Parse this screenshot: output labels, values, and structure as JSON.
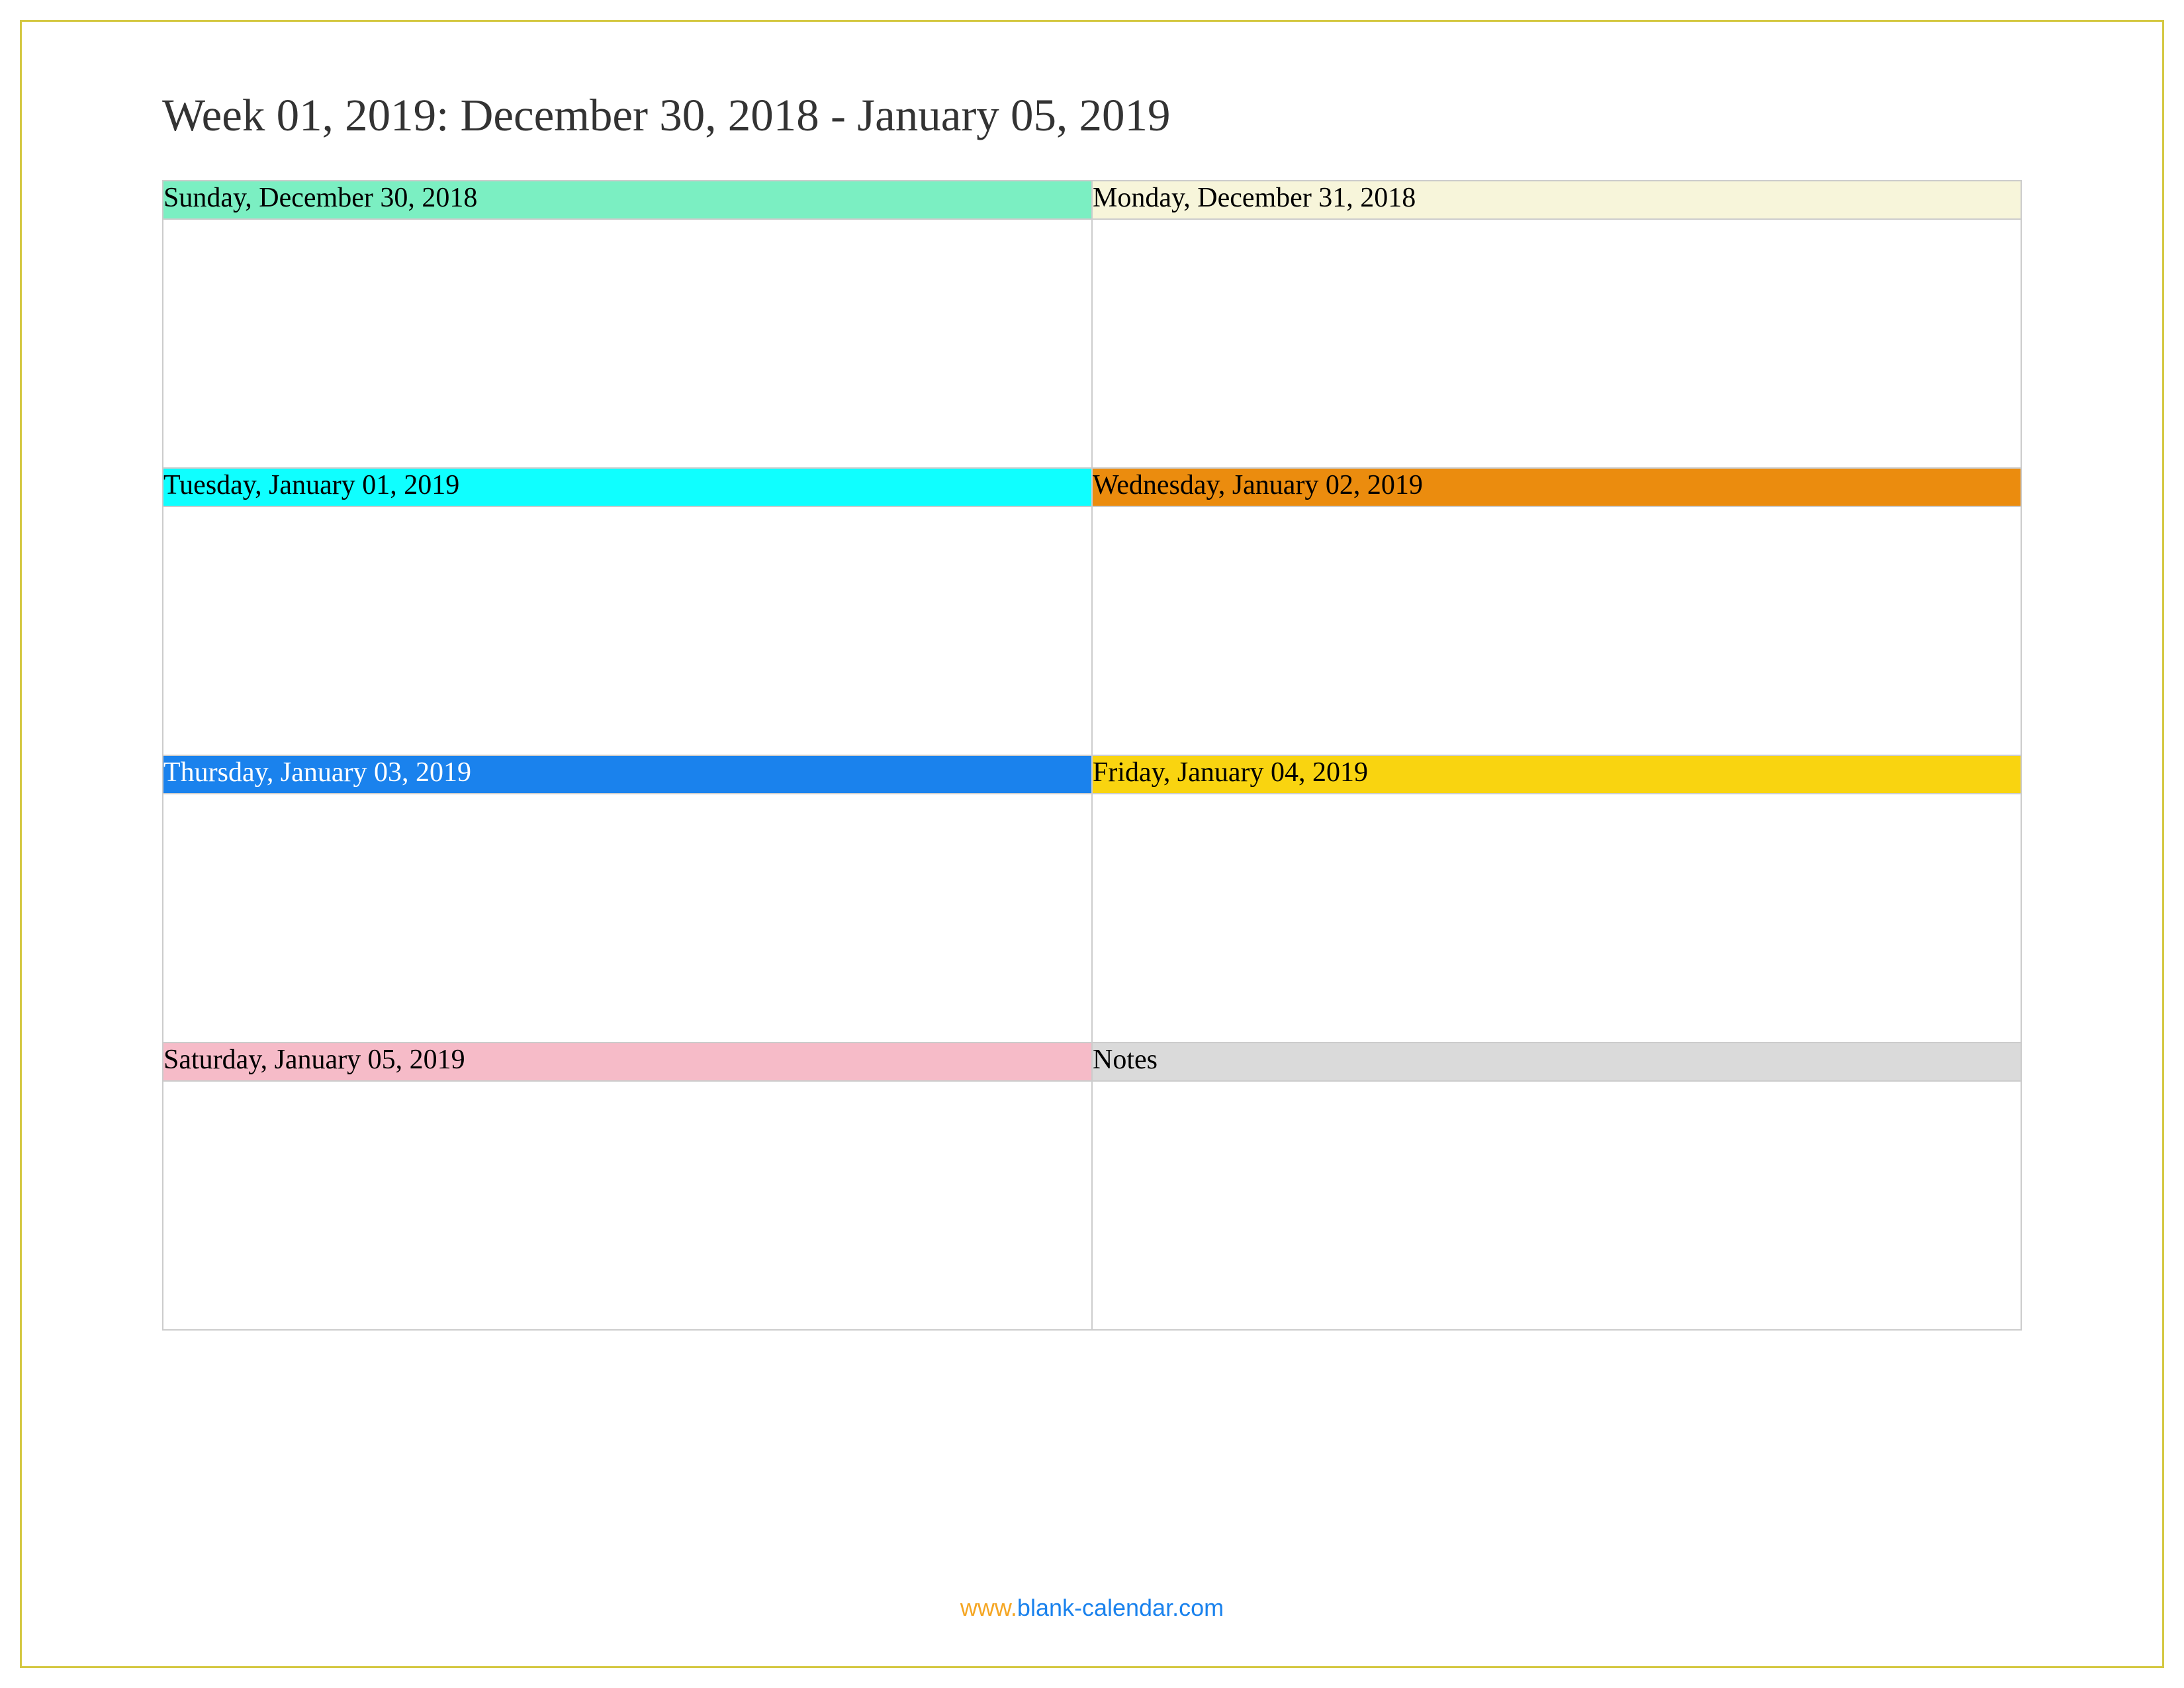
{
  "title": "Week 01, 2019: December 30, 2018 - January 05, 2019",
  "cells": {
    "sunday": {
      "label": "Sunday, December 30, 2018",
      "color": "mint"
    },
    "monday": {
      "label": "Monday, December 31, 2018",
      "color": "cream"
    },
    "tuesday": {
      "label": "Tuesday, January 01, 2019",
      "color": "cyan"
    },
    "wednesday": {
      "label": "Wednesday, January 02, 2019",
      "color": "orange"
    },
    "thursday": {
      "label": "Thursday, January 03, 2019",
      "color": "blue"
    },
    "friday": {
      "label": "Friday, January 04, 2019",
      "color": "yellow"
    },
    "saturday": {
      "label": "Saturday, January 05, 2019",
      "color": "pink"
    },
    "notes": {
      "label": "Notes",
      "color": "gray"
    }
  },
  "footer": {
    "prefix": "www.",
    "domain": "blank-calendar.com"
  }
}
